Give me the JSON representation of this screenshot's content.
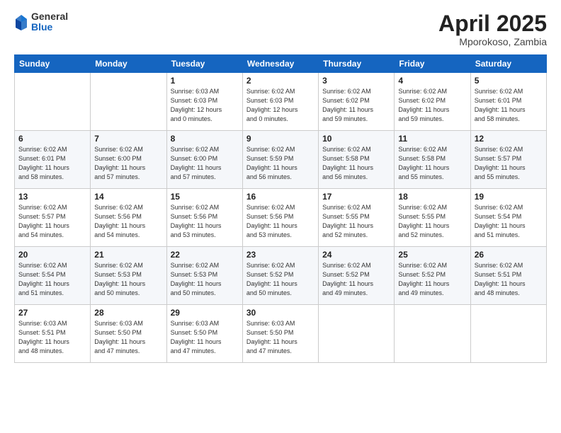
{
  "header": {
    "logo_general": "General",
    "logo_blue": "Blue",
    "month_title": "April 2025",
    "location": "Mporokoso, Zambia"
  },
  "weekdays": [
    "Sunday",
    "Monday",
    "Tuesday",
    "Wednesday",
    "Thursday",
    "Friday",
    "Saturday"
  ],
  "weeks": [
    [
      {
        "day": "",
        "info": ""
      },
      {
        "day": "",
        "info": ""
      },
      {
        "day": "1",
        "info": "Sunrise: 6:03 AM\nSunset: 6:03 PM\nDaylight: 12 hours\nand 0 minutes."
      },
      {
        "day": "2",
        "info": "Sunrise: 6:02 AM\nSunset: 6:03 PM\nDaylight: 12 hours\nand 0 minutes."
      },
      {
        "day": "3",
        "info": "Sunrise: 6:02 AM\nSunset: 6:02 PM\nDaylight: 11 hours\nand 59 minutes."
      },
      {
        "day": "4",
        "info": "Sunrise: 6:02 AM\nSunset: 6:02 PM\nDaylight: 11 hours\nand 59 minutes."
      },
      {
        "day": "5",
        "info": "Sunrise: 6:02 AM\nSunset: 6:01 PM\nDaylight: 11 hours\nand 58 minutes."
      }
    ],
    [
      {
        "day": "6",
        "info": "Sunrise: 6:02 AM\nSunset: 6:01 PM\nDaylight: 11 hours\nand 58 minutes."
      },
      {
        "day": "7",
        "info": "Sunrise: 6:02 AM\nSunset: 6:00 PM\nDaylight: 11 hours\nand 57 minutes."
      },
      {
        "day": "8",
        "info": "Sunrise: 6:02 AM\nSunset: 6:00 PM\nDaylight: 11 hours\nand 57 minutes."
      },
      {
        "day": "9",
        "info": "Sunrise: 6:02 AM\nSunset: 5:59 PM\nDaylight: 11 hours\nand 56 minutes."
      },
      {
        "day": "10",
        "info": "Sunrise: 6:02 AM\nSunset: 5:58 PM\nDaylight: 11 hours\nand 56 minutes."
      },
      {
        "day": "11",
        "info": "Sunrise: 6:02 AM\nSunset: 5:58 PM\nDaylight: 11 hours\nand 55 minutes."
      },
      {
        "day": "12",
        "info": "Sunrise: 6:02 AM\nSunset: 5:57 PM\nDaylight: 11 hours\nand 55 minutes."
      }
    ],
    [
      {
        "day": "13",
        "info": "Sunrise: 6:02 AM\nSunset: 5:57 PM\nDaylight: 11 hours\nand 54 minutes."
      },
      {
        "day": "14",
        "info": "Sunrise: 6:02 AM\nSunset: 5:56 PM\nDaylight: 11 hours\nand 54 minutes."
      },
      {
        "day": "15",
        "info": "Sunrise: 6:02 AM\nSunset: 5:56 PM\nDaylight: 11 hours\nand 53 minutes."
      },
      {
        "day": "16",
        "info": "Sunrise: 6:02 AM\nSunset: 5:56 PM\nDaylight: 11 hours\nand 53 minutes."
      },
      {
        "day": "17",
        "info": "Sunrise: 6:02 AM\nSunset: 5:55 PM\nDaylight: 11 hours\nand 52 minutes."
      },
      {
        "day": "18",
        "info": "Sunrise: 6:02 AM\nSunset: 5:55 PM\nDaylight: 11 hours\nand 52 minutes."
      },
      {
        "day": "19",
        "info": "Sunrise: 6:02 AM\nSunset: 5:54 PM\nDaylight: 11 hours\nand 51 minutes."
      }
    ],
    [
      {
        "day": "20",
        "info": "Sunrise: 6:02 AM\nSunset: 5:54 PM\nDaylight: 11 hours\nand 51 minutes."
      },
      {
        "day": "21",
        "info": "Sunrise: 6:02 AM\nSunset: 5:53 PM\nDaylight: 11 hours\nand 50 minutes."
      },
      {
        "day": "22",
        "info": "Sunrise: 6:02 AM\nSunset: 5:53 PM\nDaylight: 11 hours\nand 50 minutes."
      },
      {
        "day": "23",
        "info": "Sunrise: 6:02 AM\nSunset: 5:52 PM\nDaylight: 11 hours\nand 50 minutes."
      },
      {
        "day": "24",
        "info": "Sunrise: 6:02 AM\nSunset: 5:52 PM\nDaylight: 11 hours\nand 49 minutes."
      },
      {
        "day": "25",
        "info": "Sunrise: 6:02 AM\nSunset: 5:52 PM\nDaylight: 11 hours\nand 49 minutes."
      },
      {
        "day": "26",
        "info": "Sunrise: 6:02 AM\nSunset: 5:51 PM\nDaylight: 11 hours\nand 48 minutes."
      }
    ],
    [
      {
        "day": "27",
        "info": "Sunrise: 6:03 AM\nSunset: 5:51 PM\nDaylight: 11 hours\nand 48 minutes."
      },
      {
        "day": "28",
        "info": "Sunrise: 6:03 AM\nSunset: 5:50 PM\nDaylight: 11 hours\nand 47 minutes."
      },
      {
        "day": "29",
        "info": "Sunrise: 6:03 AM\nSunset: 5:50 PM\nDaylight: 11 hours\nand 47 minutes."
      },
      {
        "day": "30",
        "info": "Sunrise: 6:03 AM\nSunset: 5:50 PM\nDaylight: 11 hours\nand 47 minutes."
      },
      {
        "day": "",
        "info": ""
      },
      {
        "day": "",
        "info": ""
      },
      {
        "day": "",
        "info": ""
      }
    ]
  ]
}
